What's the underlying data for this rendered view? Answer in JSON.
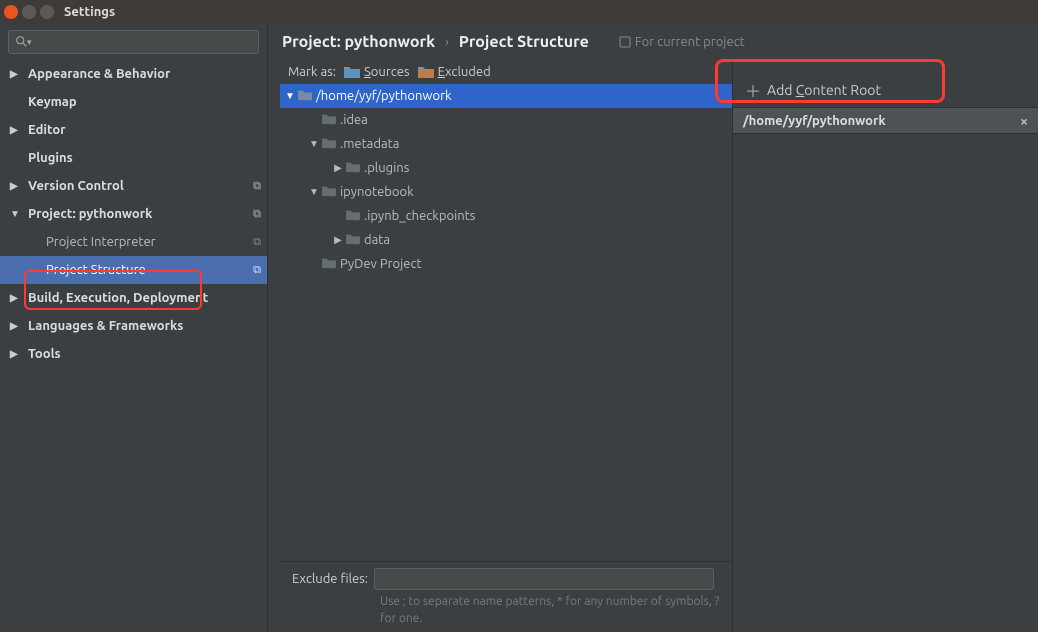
{
  "window": {
    "title": "Settings"
  },
  "sidebar": {
    "items": [
      {
        "label": "Appearance & Behavior",
        "bold": true,
        "expandable": true
      },
      {
        "label": "Keymap",
        "bold": true
      },
      {
        "label": "Editor",
        "bold": true,
        "expandable": true
      },
      {
        "label": "Plugins",
        "bold": true
      },
      {
        "label": "Version Control",
        "bold": true,
        "expandable": true,
        "marker": true
      },
      {
        "label": "Project: pythonwork",
        "bold": true,
        "expandable": true,
        "open": true,
        "marker": true
      },
      {
        "label": "Project Interpreter",
        "indent": true,
        "marker": true
      },
      {
        "label": "Project Structure",
        "indent": true,
        "selected": true,
        "marker": true
      },
      {
        "label": "Build, Execution, Deployment",
        "bold": true,
        "expandable": true
      },
      {
        "label": "Languages & Frameworks",
        "bold": true,
        "expandable": true
      },
      {
        "label": "Tools",
        "bold": true,
        "expandable": true
      }
    ]
  },
  "breadcrumb": {
    "project": "Project: pythonwork",
    "page": "Project Structure",
    "hint": "For current project"
  },
  "mark": {
    "label": "Mark as:",
    "sources": "Sources",
    "excluded": "Excluded"
  },
  "tree": [
    {
      "depth": 0,
      "open": true,
      "label": "/home/yyf/pythonwork",
      "selected": true
    },
    {
      "depth": 1,
      "label": ".idea"
    },
    {
      "depth": 1,
      "open": true,
      "expandable": true,
      "label": ".metadata"
    },
    {
      "depth": 2,
      "expandable": true,
      "label": ".plugins"
    },
    {
      "depth": 1,
      "open": true,
      "expandable": true,
      "label": "ipynotebook"
    },
    {
      "depth": 2,
      "label": ".ipynb_checkpoints"
    },
    {
      "depth": 2,
      "expandable": true,
      "label": "data"
    },
    {
      "depth": 1,
      "label": "PyDev Project"
    }
  ],
  "content_root": {
    "add_label": "Add Content Root",
    "path": "/home/yyf/pythonwork"
  },
  "footer": {
    "label": "Exclude files:",
    "hint": "Use ; to separate name patterns, * for any number of symbols, ? for one."
  }
}
